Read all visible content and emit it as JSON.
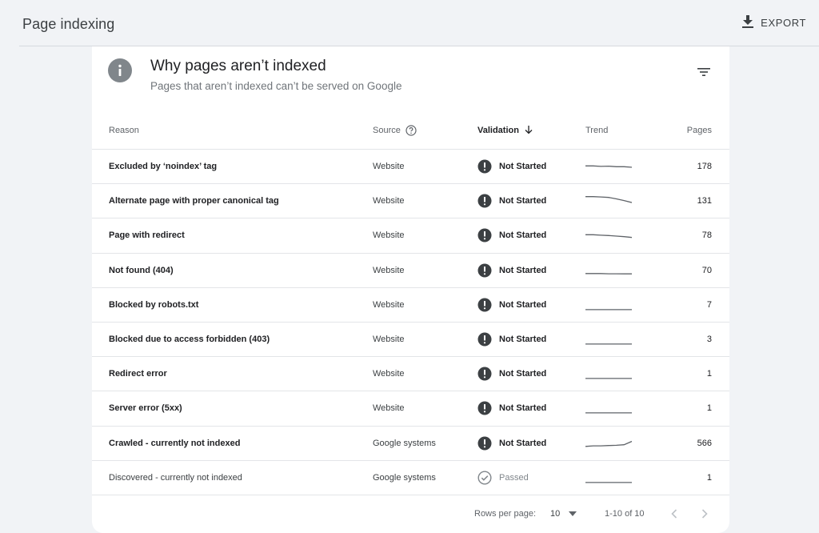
{
  "header": {
    "title": "Page indexing",
    "export_label": "EXPORT"
  },
  "card": {
    "title": "Why pages aren’t indexed",
    "subtitle": "Pages that aren’t indexed can’t be served on Google"
  },
  "table": {
    "columns": {
      "reason": "Reason",
      "source": "Source",
      "validation": "Validation",
      "trend": "Trend",
      "pages": "Pages"
    },
    "rows": [
      {
        "reason": "Excluded by ‘noindex’ tag",
        "source": "Website",
        "validation": "Not Started",
        "status": "not-started",
        "pages": "178",
        "trend": [
          0.62,
          0.62,
          0.58,
          0.6,
          0.55,
          0.55,
          0.5
        ]
      },
      {
        "reason": "Alternate page with proper canonical tag",
        "source": "Website",
        "validation": "Not Started",
        "status": "not-started",
        "pages": "131",
        "trend": [
          0.95,
          0.95,
          0.92,
          0.88,
          0.75,
          0.6,
          0.42
        ]
      },
      {
        "reason": "Page with redirect",
        "source": "Website",
        "validation": "Not Started",
        "status": "not-started",
        "pages": "78",
        "trend": [
          0.62,
          0.62,
          0.58,
          0.55,
          0.5,
          0.45,
          0.38
        ]
      },
      {
        "reason": "Not found (404)",
        "source": "Website",
        "validation": "Not Started",
        "status": "not-started",
        "pages": "70",
        "trend": [
          0.3,
          0.3,
          0.3,
          0.28,
          0.28,
          0.27,
          0.27
        ]
      },
      {
        "reason": "Blocked by robots.txt",
        "source": "Website",
        "validation": "Not Started",
        "status": "not-started",
        "pages": "7",
        "trend": [
          0.15,
          0.15,
          0.15,
          0.15,
          0.15,
          0.15,
          0.15
        ]
      },
      {
        "reason": "Blocked due to access forbidden (403)",
        "source": "Website",
        "validation": "Not Started",
        "status": "not-started",
        "pages": "3",
        "trend": [
          0.15,
          0.15,
          0.15,
          0.15,
          0.15,
          0.15,
          0.15
        ]
      },
      {
        "reason": "Redirect error",
        "source": "Website",
        "validation": "Not Started",
        "status": "not-started",
        "pages": "1",
        "trend": [
          0.15,
          0.15,
          0.15,
          0.15,
          0.15,
          0.15,
          0.15
        ]
      },
      {
        "reason": "Server error (5xx)",
        "source": "Website",
        "validation": "Not Started",
        "status": "not-started",
        "pages": "1",
        "trend": [
          0.15,
          0.15,
          0.15,
          0.15,
          0.15,
          0.15,
          0.15
        ]
      },
      {
        "reason": "Crawled - currently not indexed",
        "source": "Google systems",
        "validation": "Not Started",
        "status": "not-started",
        "pages": "566",
        "trend": [
          0.3,
          0.35,
          0.35,
          0.38,
          0.4,
          0.45,
          0.75
        ]
      },
      {
        "reason": "Discovered - currently not indexed",
        "source": "Google systems",
        "validation": "Passed",
        "status": "passed",
        "pages": "1",
        "trend": [
          0.15,
          0.15,
          0.15,
          0.15,
          0.15,
          0.15,
          0.15
        ]
      }
    ]
  },
  "pagination": {
    "rows_per_page_label": "Rows per page:",
    "rows_per_page": "10",
    "range": "1-10 of 10"
  },
  "colors": {
    "background": "#f1f3f6",
    "card": "#ffffff",
    "status_icon": "#3c4043",
    "passed_icon": "#80868b",
    "trend_line": "#5f6368"
  },
  "icons": {
    "export": "download-icon",
    "info": "info-icon",
    "filter": "filter-icon",
    "help": "help-circle-icon",
    "sort": "arrow-down-icon",
    "not_started": "exclamation-circle-icon",
    "passed": "check-circle-icon",
    "prev": "chevron-left-icon",
    "next": "chevron-right-icon",
    "dropdown": "caret-down-icon"
  }
}
